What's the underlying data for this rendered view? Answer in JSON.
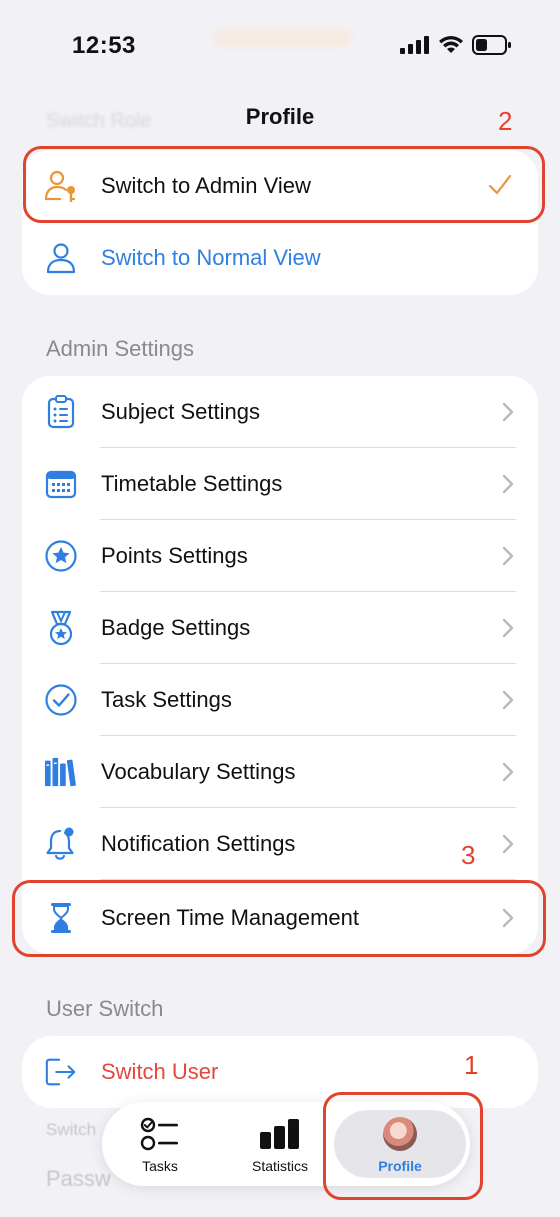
{
  "status_bar": {
    "time": "12:53"
  },
  "nav": {
    "title": "Profile"
  },
  "switch_role": {
    "ghost_header": "Switch Role",
    "admin_label": "Switch to Admin View",
    "normal_label": "Switch to Normal View"
  },
  "admin_settings": {
    "title": "Admin Settings",
    "items": [
      {
        "label": "Subject Settings",
        "icon": "clipboard-list-icon"
      },
      {
        "label": "Timetable Settings",
        "icon": "calendar-icon"
      },
      {
        "label": "Points Settings",
        "icon": "star-circle-icon"
      },
      {
        "label": "Badge Settings",
        "icon": "medal-icon"
      },
      {
        "label": "Task Settings",
        "icon": "checkmark-circle-icon"
      },
      {
        "label": "Vocabulary Settings",
        "icon": "books-icon"
      },
      {
        "label": "Notification Settings",
        "icon": "bell-badge-icon"
      },
      {
        "label": "Screen Time Management",
        "icon": "hourglass-icon"
      }
    ]
  },
  "user_switch": {
    "title": "User Switch",
    "switch_user_label": "Switch User",
    "footer_fragment": "Switch",
    "password_fragment": "Passw"
  },
  "annotations": [
    "1",
    "2",
    "3"
  ],
  "tabbar": {
    "tasks_label": "Tasks",
    "statistics_label": "Statistics",
    "profile_label": "Profile"
  },
  "colors": {
    "accent_blue": "#2f7fe0",
    "accent_orange": "#e9953a",
    "destructive_red": "#e5473e",
    "annotation_red": "#e0442e",
    "background": "#f2f1f6"
  }
}
